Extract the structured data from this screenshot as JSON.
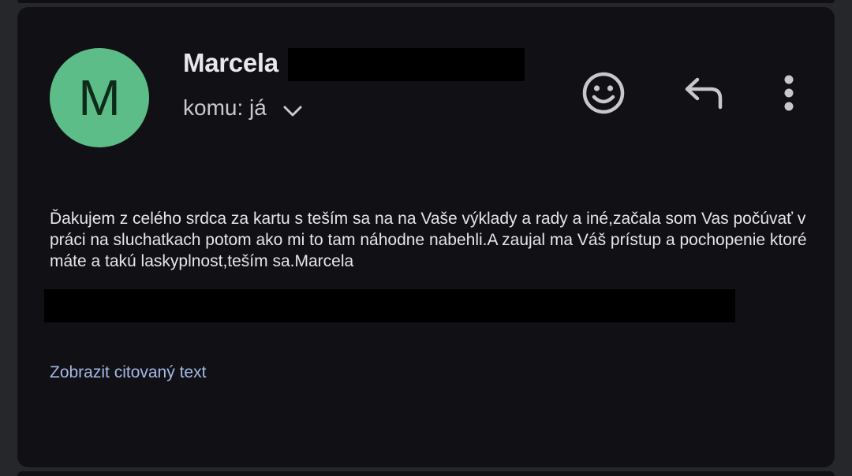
{
  "email": {
    "avatar_letter": "M",
    "avatar_color": "#5dbd88",
    "sender_name": "Marcela",
    "recipient_label": "komu: já",
    "body": "Ďakujem z celého srdca za kartu s teším sa na na Vaše výklady a rady a iné,začala som Vas počúvať v práci na sluchatkach potom ako mi to tam náhodne nabehli.A zaujal ma Váš prístup a pochopenie ktoré máte a takú laskyplnost,teším sa.Marcela",
    "show_quoted_label": "Zobrazit citovaný text"
  },
  "icons": {
    "expand": "chevron-down-icon",
    "emoji": "smiley-icon",
    "reply": "reply-icon",
    "more": "more-vertical-icon"
  },
  "colors": {
    "background": "#111115",
    "link": "#a4b9e6",
    "text": "#e6e6e8"
  }
}
